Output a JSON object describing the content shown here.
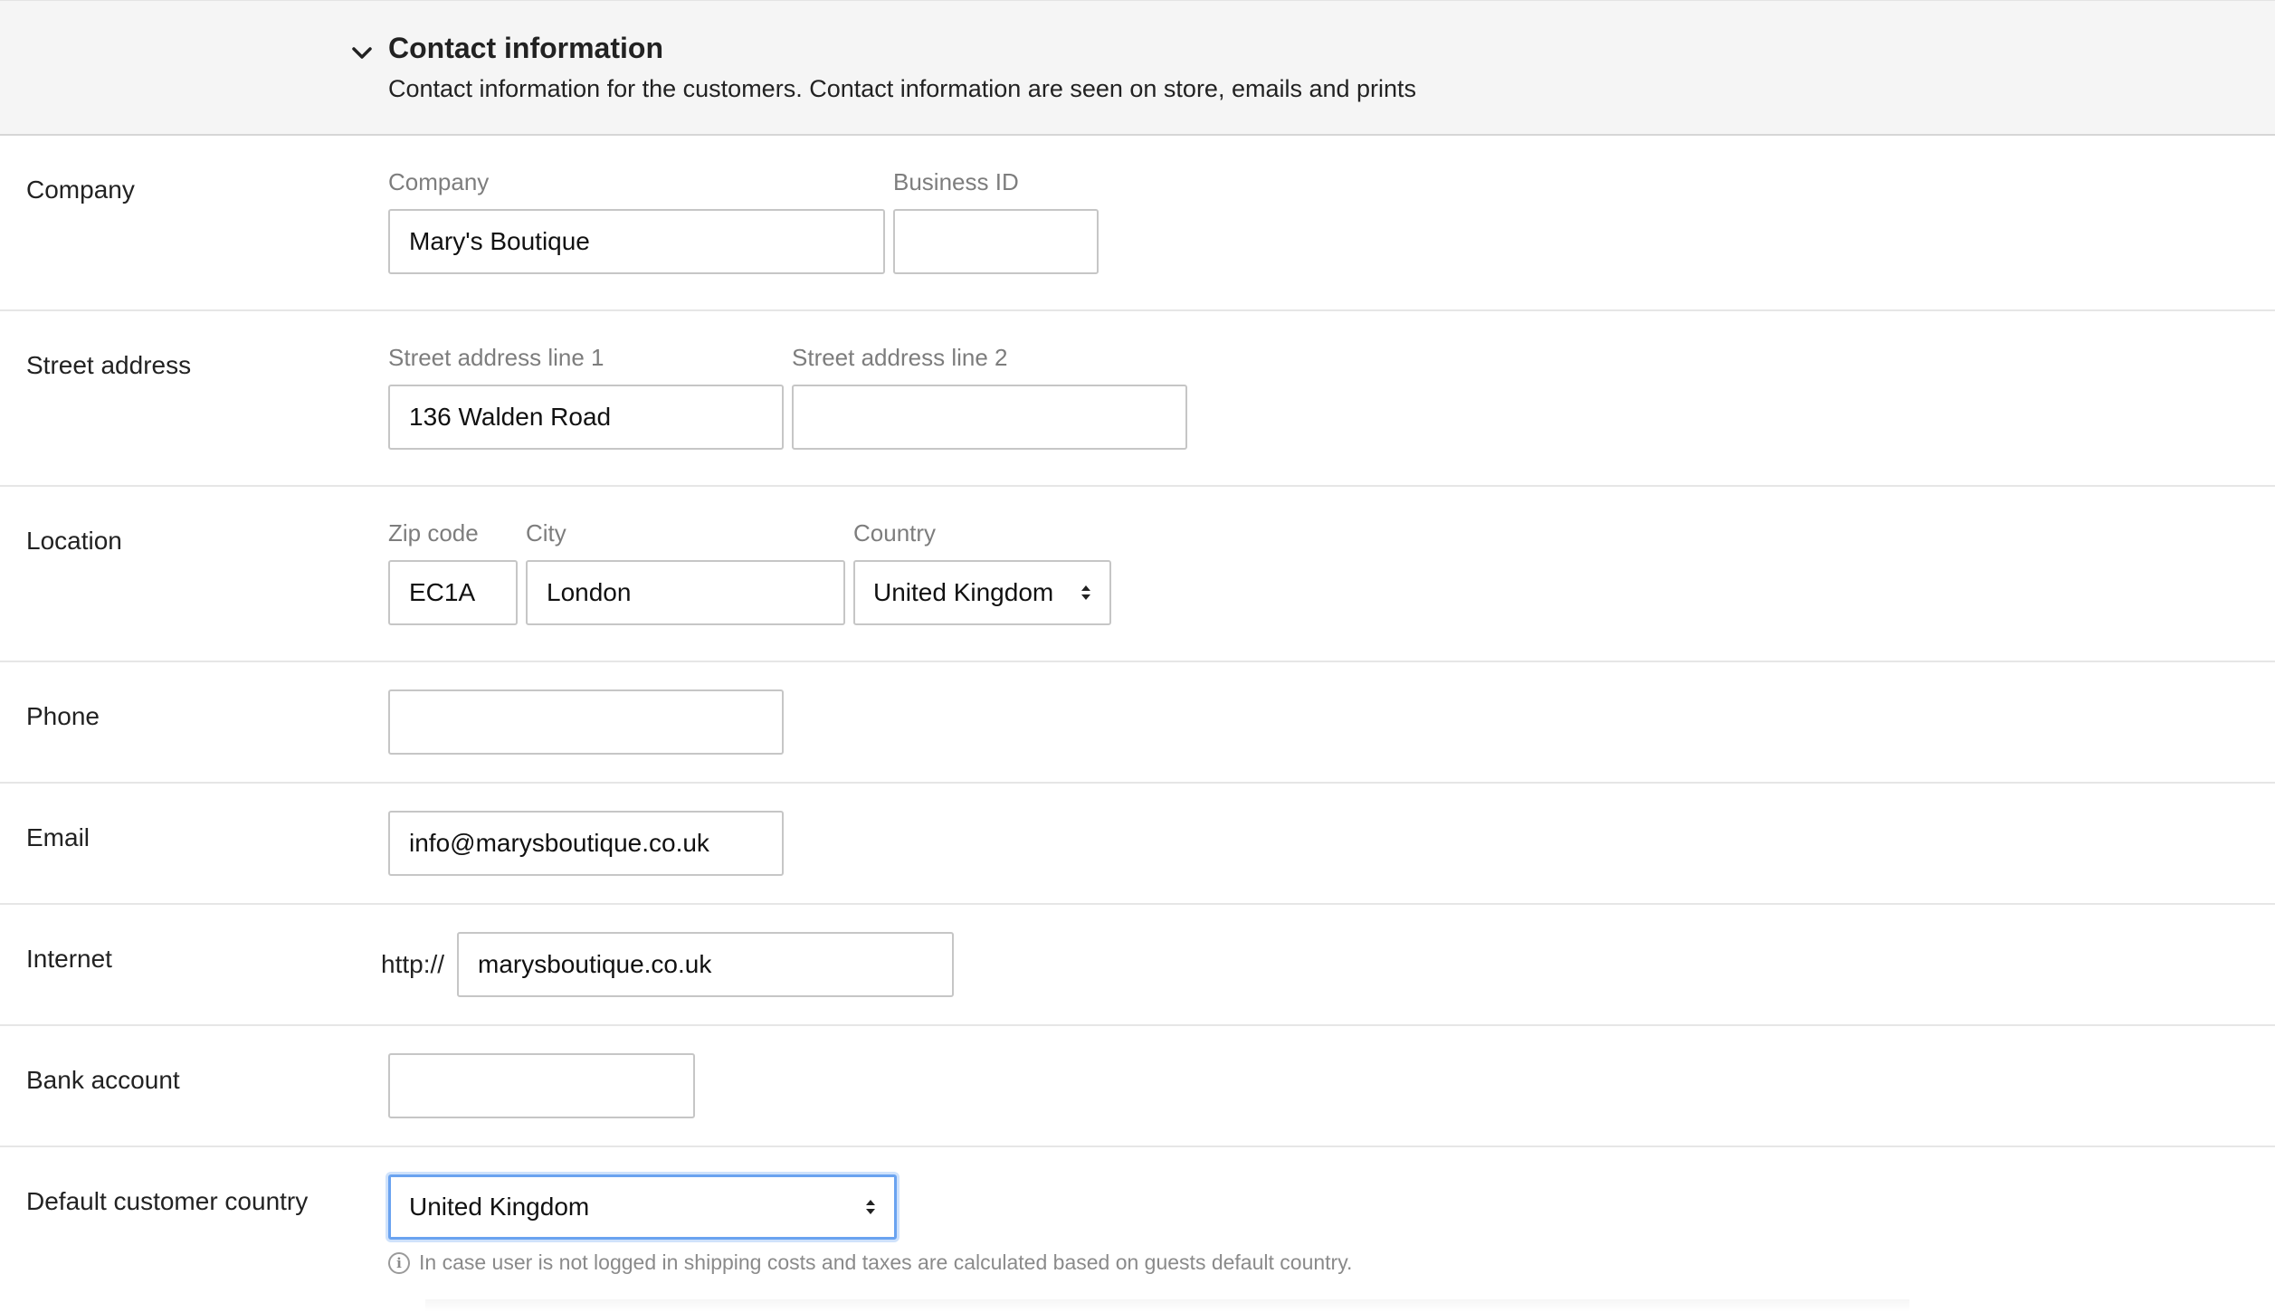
{
  "section": {
    "title": "Contact information",
    "description": "Contact information for the customers. Contact information are seen on store, emails and prints"
  },
  "company": {
    "row_label": "Company",
    "company_label": "Company",
    "company_value": "Mary's Boutique",
    "business_id_label": "Business ID",
    "business_id_value": ""
  },
  "street": {
    "row_label": "Street address",
    "line1_label": "Street address line 1",
    "line1_value": "136  Walden Road",
    "line2_label": "Street address line 2",
    "line2_value": ""
  },
  "location": {
    "row_label": "Location",
    "zip_label": "Zip code",
    "zip_value": "EC1A",
    "city_label": "City",
    "city_value": "London",
    "country_label": "Country",
    "country_value": "United Kingdom"
  },
  "phone": {
    "row_label": "Phone",
    "value": ""
  },
  "email": {
    "row_label": "Email",
    "value": "info@marysboutique.co.uk"
  },
  "internet": {
    "row_label": "Internet",
    "prefix": "http://",
    "value": "marysboutique.co.uk"
  },
  "bank": {
    "row_label": "Bank account",
    "value": ""
  },
  "default_country": {
    "row_label": "Default customer country",
    "value": "United Kingdom",
    "hint": "In case user is not logged in shipping costs and taxes are calculated based on guests default country."
  },
  "icons": {
    "collapse": "chevron-down-icon",
    "select": "sort-arrows-icon",
    "info": "info-circle-icon"
  },
  "colors": {
    "header_bg": "#f5f5f5",
    "focus_border": "#6aa3f0",
    "label_gray": "#7d7d7d"
  }
}
